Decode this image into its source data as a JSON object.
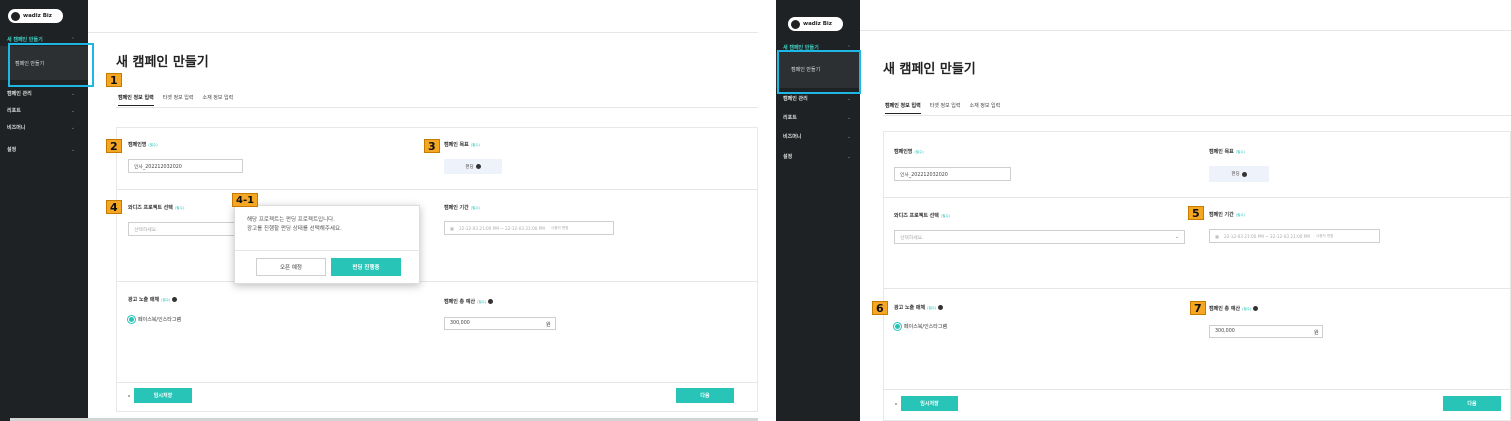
{
  "brand": {
    "logo_text": "wadiz Biz"
  },
  "accent_color": "#27c4b7",
  "highlight_color": "#1fb6e3",
  "badge_color": "#f5a623",
  "sidebar": {
    "new_campaign": "새 캠페인 만들기",
    "submenu_item": "캠페인 만들기",
    "items": [
      "캠페인 관리",
      "리포트",
      "비즈머니",
      "설정"
    ]
  },
  "page": {
    "title": "새 캠페인 만들기",
    "tabs": [
      "캠페인 정보 입력",
      "타겟 정보 입력",
      "소재 정보 입력"
    ]
  },
  "form": {
    "campaign_name_label": "캠페인명",
    "required": "(필수)",
    "campaign_name_value": "인사_202212032020",
    "goal_label": "캠페인 목표",
    "goal_value": "펀딩",
    "project_label": "와디즈 프로젝트 선택",
    "project_placeholder": "선택하세요.",
    "period_label": "캠페인 기간",
    "period_value": "22-12-03 21:00 PM ~ 22-12-03 21:00 PM",
    "period_tag": "사용자 변환",
    "media_label": "광고 노출 매체",
    "media_option": "페이스북/인스타그램",
    "budget_label": "캠페인 총 예산",
    "budget_value": "300,000",
    "budget_unit": "원",
    "save_draft": "임시저장",
    "next": "다음"
  },
  "modal": {
    "line1": "해당 프로젝트는 펀딩 프로젝트입니다.",
    "line2": "광고를 진행할 펀딩 상태를 선택해주세요.",
    "btn_open": "오픈 예정",
    "btn_funding": "펀딩 진행중"
  },
  "badges": {
    "b1": "1",
    "b2": "2",
    "b3": "3",
    "b4": "4",
    "b41": "4-1",
    "b5": "5",
    "b6": "6",
    "b7": "7"
  }
}
